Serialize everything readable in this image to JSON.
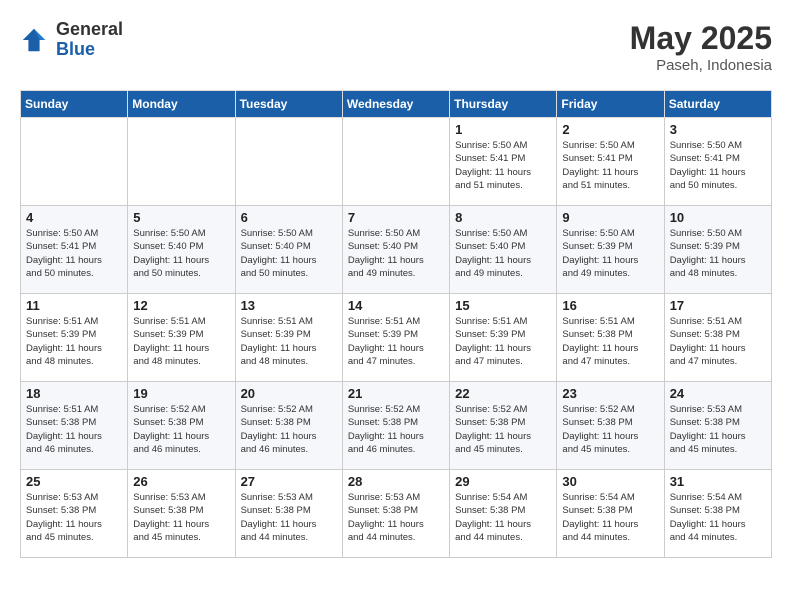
{
  "header": {
    "logo_general": "General",
    "logo_blue": "Blue",
    "month_title": "May 2025",
    "location": "Paseh, Indonesia"
  },
  "days_of_week": [
    "Sunday",
    "Monday",
    "Tuesday",
    "Wednesday",
    "Thursday",
    "Friday",
    "Saturday"
  ],
  "weeks": [
    [
      {
        "day": "",
        "info": ""
      },
      {
        "day": "",
        "info": ""
      },
      {
        "day": "",
        "info": ""
      },
      {
        "day": "",
        "info": ""
      },
      {
        "day": "1",
        "info": "Sunrise: 5:50 AM\nSunset: 5:41 PM\nDaylight: 11 hours\nand 51 minutes."
      },
      {
        "day": "2",
        "info": "Sunrise: 5:50 AM\nSunset: 5:41 PM\nDaylight: 11 hours\nand 51 minutes."
      },
      {
        "day": "3",
        "info": "Sunrise: 5:50 AM\nSunset: 5:41 PM\nDaylight: 11 hours\nand 50 minutes."
      }
    ],
    [
      {
        "day": "4",
        "info": "Sunrise: 5:50 AM\nSunset: 5:41 PM\nDaylight: 11 hours\nand 50 minutes."
      },
      {
        "day": "5",
        "info": "Sunrise: 5:50 AM\nSunset: 5:40 PM\nDaylight: 11 hours\nand 50 minutes."
      },
      {
        "day": "6",
        "info": "Sunrise: 5:50 AM\nSunset: 5:40 PM\nDaylight: 11 hours\nand 50 minutes."
      },
      {
        "day": "7",
        "info": "Sunrise: 5:50 AM\nSunset: 5:40 PM\nDaylight: 11 hours\nand 49 minutes."
      },
      {
        "day": "8",
        "info": "Sunrise: 5:50 AM\nSunset: 5:40 PM\nDaylight: 11 hours\nand 49 minutes."
      },
      {
        "day": "9",
        "info": "Sunrise: 5:50 AM\nSunset: 5:39 PM\nDaylight: 11 hours\nand 49 minutes."
      },
      {
        "day": "10",
        "info": "Sunrise: 5:50 AM\nSunset: 5:39 PM\nDaylight: 11 hours\nand 48 minutes."
      }
    ],
    [
      {
        "day": "11",
        "info": "Sunrise: 5:51 AM\nSunset: 5:39 PM\nDaylight: 11 hours\nand 48 minutes."
      },
      {
        "day": "12",
        "info": "Sunrise: 5:51 AM\nSunset: 5:39 PM\nDaylight: 11 hours\nand 48 minutes."
      },
      {
        "day": "13",
        "info": "Sunrise: 5:51 AM\nSunset: 5:39 PM\nDaylight: 11 hours\nand 48 minutes."
      },
      {
        "day": "14",
        "info": "Sunrise: 5:51 AM\nSunset: 5:39 PM\nDaylight: 11 hours\nand 47 minutes."
      },
      {
        "day": "15",
        "info": "Sunrise: 5:51 AM\nSunset: 5:39 PM\nDaylight: 11 hours\nand 47 minutes."
      },
      {
        "day": "16",
        "info": "Sunrise: 5:51 AM\nSunset: 5:38 PM\nDaylight: 11 hours\nand 47 minutes."
      },
      {
        "day": "17",
        "info": "Sunrise: 5:51 AM\nSunset: 5:38 PM\nDaylight: 11 hours\nand 47 minutes."
      }
    ],
    [
      {
        "day": "18",
        "info": "Sunrise: 5:51 AM\nSunset: 5:38 PM\nDaylight: 11 hours\nand 46 minutes."
      },
      {
        "day": "19",
        "info": "Sunrise: 5:52 AM\nSunset: 5:38 PM\nDaylight: 11 hours\nand 46 minutes."
      },
      {
        "day": "20",
        "info": "Sunrise: 5:52 AM\nSunset: 5:38 PM\nDaylight: 11 hours\nand 46 minutes."
      },
      {
        "day": "21",
        "info": "Sunrise: 5:52 AM\nSunset: 5:38 PM\nDaylight: 11 hours\nand 46 minutes."
      },
      {
        "day": "22",
        "info": "Sunrise: 5:52 AM\nSunset: 5:38 PM\nDaylight: 11 hours\nand 45 minutes."
      },
      {
        "day": "23",
        "info": "Sunrise: 5:52 AM\nSunset: 5:38 PM\nDaylight: 11 hours\nand 45 minutes."
      },
      {
        "day": "24",
        "info": "Sunrise: 5:53 AM\nSunset: 5:38 PM\nDaylight: 11 hours\nand 45 minutes."
      }
    ],
    [
      {
        "day": "25",
        "info": "Sunrise: 5:53 AM\nSunset: 5:38 PM\nDaylight: 11 hours\nand 45 minutes."
      },
      {
        "day": "26",
        "info": "Sunrise: 5:53 AM\nSunset: 5:38 PM\nDaylight: 11 hours\nand 45 minutes."
      },
      {
        "day": "27",
        "info": "Sunrise: 5:53 AM\nSunset: 5:38 PM\nDaylight: 11 hours\nand 44 minutes."
      },
      {
        "day": "28",
        "info": "Sunrise: 5:53 AM\nSunset: 5:38 PM\nDaylight: 11 hours\nand 44 minutes."
      },
      {
        "day": "29",
        "info": "Sunrise: 5:54 AM\nSunset: 5:38 PM\nDaylight: 11 hours\nand 44 minutes."
      },
      {
        "day": "30",
        "info": "Sunrise: 5:54 AM\nSunset: 5:38 PM\nDaylight: 11 hours\nand 44 minutes."
      },
      {
        "day": "31",
        "info": "Sunrise: 5:54 AM\nSunset: 5:38 PM\nDaylight: 11 hours\nand 44 minutes."
      }
    ]
  ]
}
